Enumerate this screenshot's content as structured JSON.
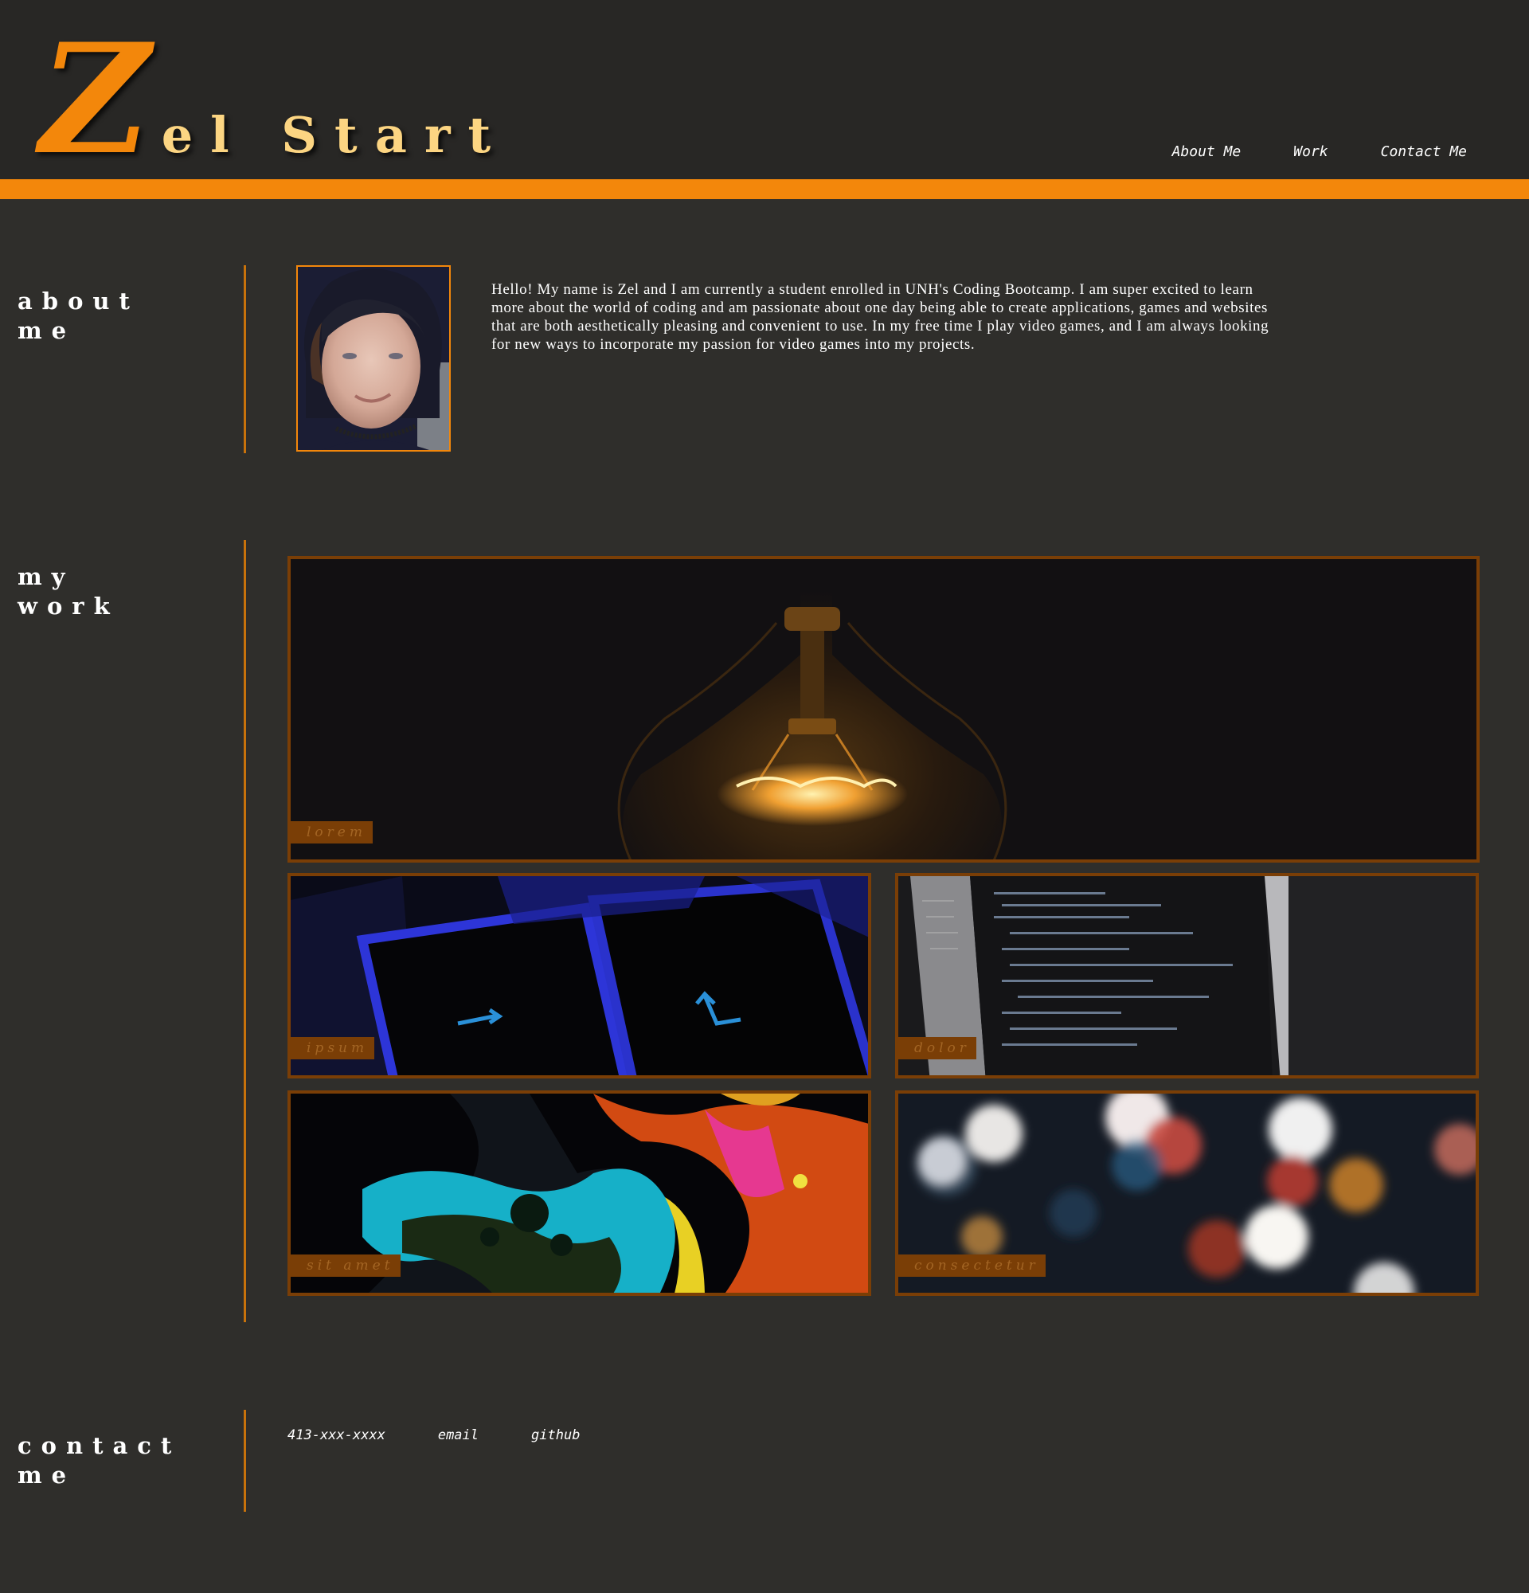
{
  "header": {
    "logo_initial": "Z",
    "logo_rest": "el Start",
    "nav": [
      "About Me",
      "Work",
      "Contact Me"
    ]
  },
  "about": {
    "title_line1": "about",
    "title_line2": "me",
    "text": "Hello! My name is Zel and I am currently a student enrolled in UNH's Coding Bootcamp. I am super excited to learn more about the world of coding and am passionate about one day being able to create applications, games and websites that are both aesthetically pleasing and convenient to use. In my free time I play video games, and I am always looking for new ways to incorporate my passion for video games into my projects."
  },
  "work": {
    "title_line1": "my",
    "title_line2": "work",
    "items": [
      {
        "label": "lorem"
      },
      {
        "label": "ipsum"
      },
      {
        "label": "dolor"
      },
      {
        "label": "sit amet"
      },
      {
        "label": "consectetur"
      }
    ]
  },
  "contact": {
    "title_line1": "contact",
    "title_line2": "me",
    "links": [
      "413-xxx-xxxx",
      "email",
      "github"
    ]
  },
  "colors": {
    "background": "#2f2e2b",
    "header": "#282725",
    "accent": "#f3870b",
    "logo_text": "#fcd582",
    "tile_border": "#7a3e06"
  }
}
